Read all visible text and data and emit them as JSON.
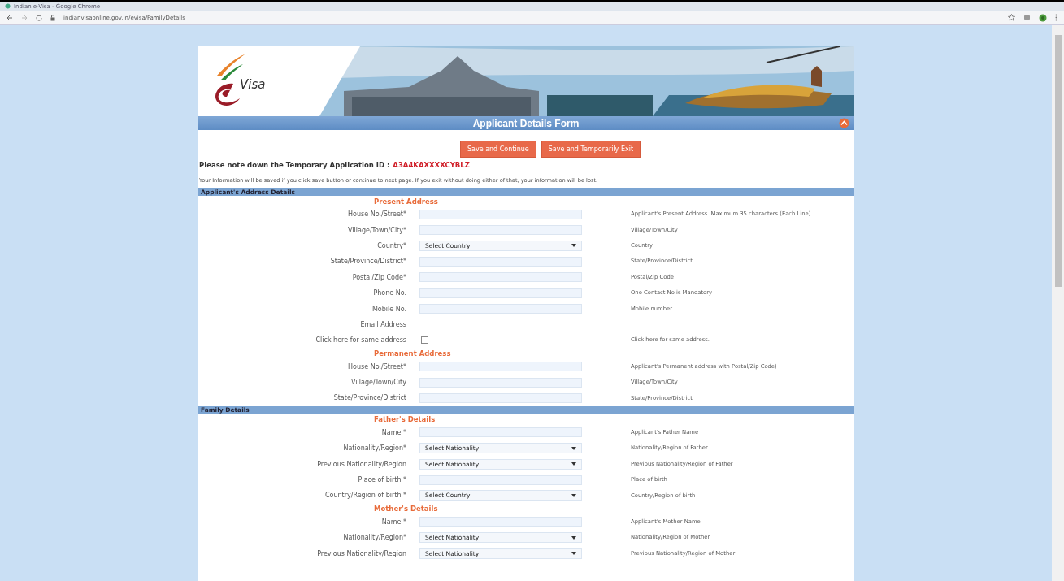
{
  "browser": {
    "title": "Indian e-Visa - Google Chrome",
    "url": "indianvisaonline.gov.in/evisa/FamilyDetails"
  },
  "banner": {
    "logo_text": "Visa"
  },
  "form_title": "Applicant Details Form",
  "buttons": [
    "Save and Continue",
    "Save and Temporarily Exit"
  ],
  "temp_id": {
    "label": "Please note down the Temporary Application ID :",
    "value": "A3A4KAXXXXCYBLZ"
  },
  "notice": "Your Information will be saved if you click save button or continue to next page. If you exit without doing either of that, your information will be lost.",
  "sections": [
    {
      "title": "Applicant's Address Details",
      "groups": [
        {
          "heading": "Present Address",
          "rows": [
            {
              "label": "House No./Street*",
              "kind": "text",
              "help": "Applicant's Present Address. Maximum 35 characters (Each Line)"
            },
            {
              "label": "Village/Town/City*",
              "kind": "text",
              "help": "Village/Town/City"
            },
            {
              "label": "Country*",
              "kind": "select",
              "value": "Select Country",
              "help": "Country"
            },
            {
              "label": "State/Province/District*",
              "kind": "text",
              "help": "State/Province/District"
            },
            {
              "label": "Postal/Zip Code*",
              "kind": "text",
              "help": "Postal/Zip Code"
            },
            {
              "label": "Phone No.",
              "kind": "text",
              "help": "One Contact No is Mandatory"
            },
            {
              "label": "Mobile No.",
              "kind": "text",
              "help": "Mobile number."
            },
            {
              "label": "Email Address",
              "kind": "none"
            },
            {
              "label": "Click here for same address",
              "kind": "checkbox",
              "checked": false,
              "help": "Click here for same address."
            }
          ]
        },
        {
          "heading": "Permanent Address",
          "rows": [
            {
              "label": "House No./Street*",
              "kind": "text",
              "help": "Applicant's Permanent address with Postal/Zip Code)"
            },
            {
              "label": "Village/Town/City",
              "kind": "text",
              "help": "Village/Town/City"
            },
            {
              "label": "State/Province/District",
              "kind": "text",
              "help": "State/Province/District"
            }
          ]
        }
      ]
    },
    {
      "title": "Family Details",
      "groups": [
        {
          "heading": "Father's Details",
          "rows": [
            {
              "label": "Name *",
              "kind": "text",
              "help": "Applicant's Father Name"
            },
            {
              "label": "Nationality/Region*",
              "kind": "select",
              "value": "Select Nationality",
              "help": "Nationality/Region of Father"
            },
            {
              "label": "Previous Nationality/Region",
              "kind": "select",
              "value": "Select Nationality",
              "help": "Previous Nationality/Region of Father"
            },
            {
              "label": "Place of birth *",
              "kind": "text",
              "help": "Place of birth"
            },
            {
              "label": "Country/Region of birth *",
              "kind": "select",
              "value": "Select Country",
              "help": "Country/Region of birth"
            }
          ]
        },
        {
          "heading": "Mother's Details",
          "rows": [
            {
              "label": "Name *",
              "kind": "text",
              "help": "Applicant's Mother Name"
            },
            {
              "label": "Nationality/Region*",
              "kind": "select",
              "value": "Select Nationality",
              "help": "Nationality/Region of Mother"
            },
            {
              "label": "Previous Nationality/Region",
              "kind": "select",
              "value": "Select Nationality",
              "help": "Previous Nationality/Region of Mother"
            }
          ]
        }
      ]
    }
  ]
}
